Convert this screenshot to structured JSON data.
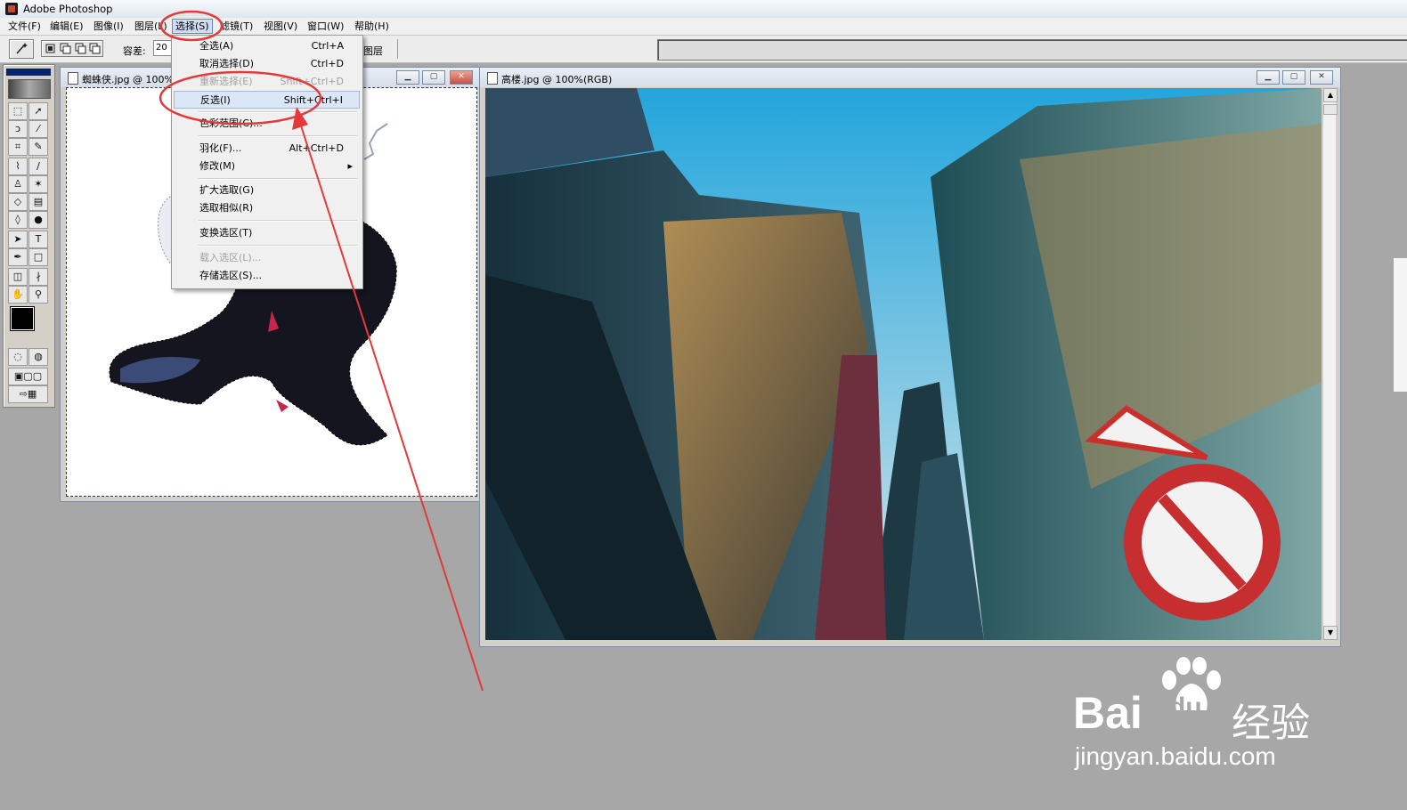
{
  "window": {
    "title": "Adobe Photoshop"
  },
  "menubar": {
    "items": [
      "文件(F)",
      "编辑(E)",
      "图像(I)",
      "图层(L)",
      "选择(S)",
      "滤镜(T)",
      "视图(V)",
      "窗口(W)",
      "帮助(H)"
    ],
    "active_index": 4
  },
  "options_bar": {
    "tolerance_label": "容差:",
    "tolerance_value": "20",
    "layers_label": "图层"
  },
  "select_menu": {
    "items": [
      {
        "label": "全选(A)",
        "shortcut": "Ctrl+A",
        "enabled": true
      },
      {
        "label": "取消选择(D)",
        "shortcut": "Ctrl+D",
        "enabled": true
      },
      {
        "label": "重新选择(E)",
        "shortcut": "Shift+Ctrl+D",
        "enabled": false
      },
      {
        "label": "反选(I)",
        "shortcut": "Shift+Ctrl+I",
        "enabled": true,
        "highlighted": true
      },
      {
        "label": "色彩范围(C)...",
        "shortcut": "",
        "enabled": true
      },
      {
        "label": "羽化(F)...",
        "shortcut": "Alt+Ctrl+D",
        "enabled": true
      },
      {
        "label": "修改(M)",
        "shortcut": "",
        "enabled": true,
        "submenu": true
      },
      {
        "label": "扩大选取(G)",
        "shortcut": "",
        "enabled": true
      },
      {
        "label": "选取相似(R)",
        "shortcut": "",
        "enabled": true
      },
      {
        "label": "变换选区(T)",
        "shortcut": "",
        "enabled": true
      },
      {
        "label": "载入选区(L)...",
        "shortcut": "",
        "enabled": false
      },
      {
        "label": "存储选区(S)...",
        "shortcut": "",
        "enabled": true
      }
    ]
  },
  "documents": [
    {
      "title": "蜘蛛侠.jpg @ 100%"
    },
    {
      "title": "高楼.jpg @ 100%(RGB)"
    }
  ],
  "watermark": {
    "brand": "Bai",
    "brand2": "du",
    "suffix": "经验",
    "url": "jingyan.baidu.com"
  },
  "colors": {
    "annotation": "#e23a3a",
    "menu_highlight": "#dbe6f6",
    "sky": "#5fb7d9"
  }
}
